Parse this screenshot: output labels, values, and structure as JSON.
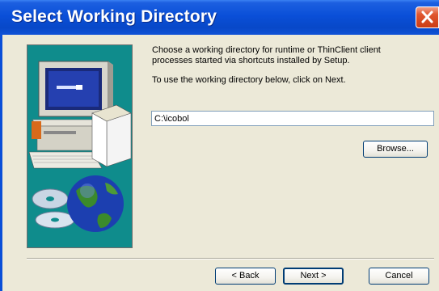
{
  "window": {
    "title": "Select Working Directory"
  },
  "content": {
    "description": "Choose a working directory for runtime or ThinClient client processes started via shortcuts installed by Setup.",
    "instruction": "To use the working directory below, click on Next.",
    "directory_value": "C:\\icobol"
  },
  "buttons": {
    "browse": "Browse...",
    "back": "< Back",
    "next": "Next >",
    "cancel": "Cancel"
  },
  "colors": {
    "titlebar": "#0a4fd8",
    "panel_bg": "#ece9d8",
    "art_bg": "#0f8c8c",
    "close_button": "#e0572f"
  }
}
